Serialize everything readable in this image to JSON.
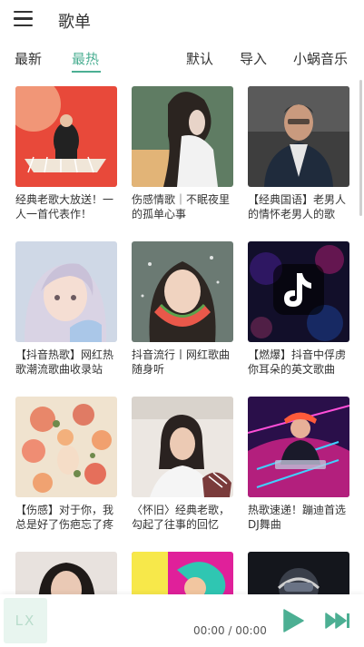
{
  "header": {
    "title": "歌单"
  },
  "tabs": {
    "latest": "最新",
    "hottest": "最热",
    "default": "默认",
    "import": "导入",
    "source": "小蜗音乐"
  },
  "playlists": [
    {
      "title": "经典老歌大放送！一人一首代表作！"
    },
    {
      "title": "伤感情歌｜不眠夜里的孤单心事"
    },
    {
      "title": "【经典国语】老男人的情怀老男人的歌"
    },
    {
      "title": "【抖音热歌】网红热歌潮流歌曲收录站"
    },
    {
      "title": "抖音流行丨网红歌曲随身听"
    },
    {
      "title": "【燃爆】抖音中俘虏你耳朵的英文歌曲"
    },
    {
      "title": "【伤感】对于你，我总是好了伤疤忘了疼"
    },
    {
      "title": "〈怀旧〉经典老歌，勾起了往事的回忆"
    },
    {
      "title": "热歌速递！蹦迪首选DJ舞曲"
    }
  ],
  "player": {
    "logo": "LX",
    "time": "00:00 / 00:00"
  },
  "colors": {
    "accent": "#4caf93"
  }
}
